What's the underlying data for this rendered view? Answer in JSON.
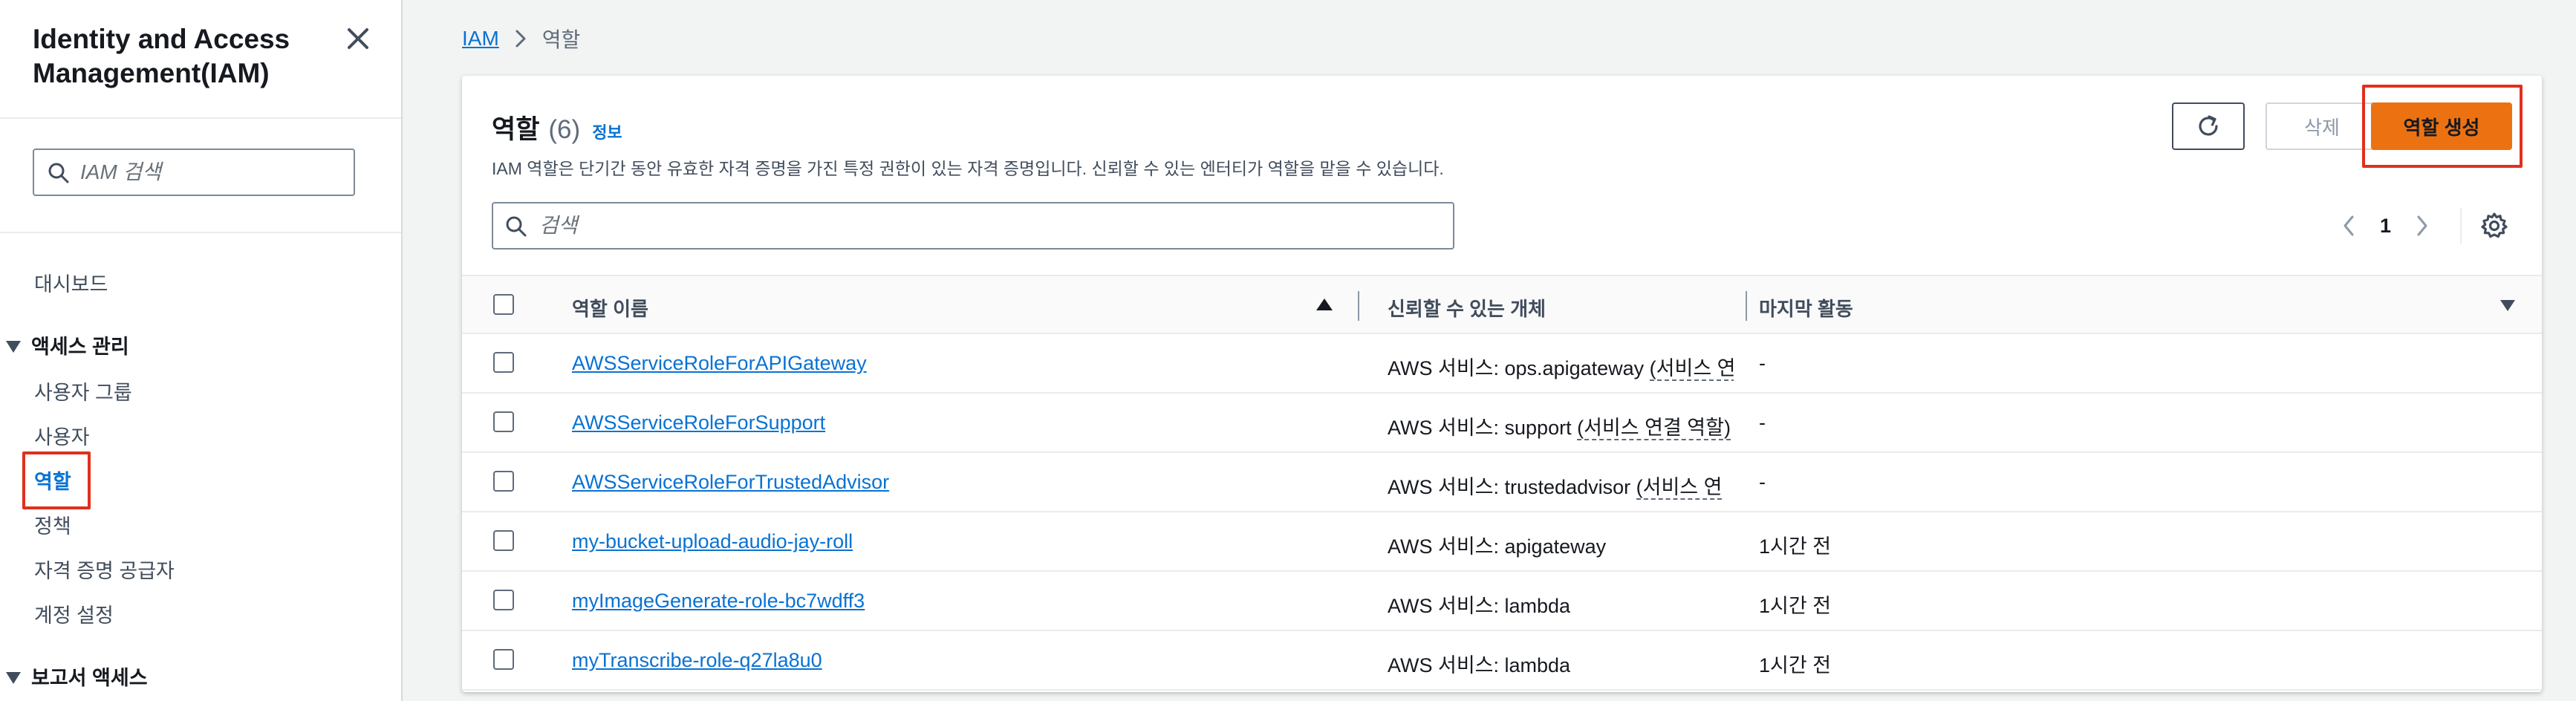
{
  "sidebar": {
    "title": "Identity and Access Management(IAM)",
    "search_placeholder": "IAM 검색",
    "dashboard": "대시보드",
    "access_section": "액세스 관리",
    "items": [
      "사용자 그룹",
      "사용자",
      "역할",
      "정책",
      "자격 증명 공급자",
      "계정 설정"
    ],
    "active_item": "역할",
    "report_section": "보고서 액세스"
  },
  "breadcrumb": {
    "root": "IAM",
    "current": "역할"
  },
  "panel": {
    "title": "역할",
    "count": "(6)",
    "info_link": "정보",
    "description": "IAM 역할은 단기간 동안 유효한 자격 증명을 가진 특정 권한이 있는 자격 증명입니다. 신뢰할 수 있는 엔터티가 역할을 맡을 수 있습니다.",
    "delete_label": "삭제",
    "create_label": "역할 생성",
    "search_placeholder": "검색",
    "page": "1"
  },
  "table": {
    "headers": [
      "역할 이름",
      "신뢰할 수 있는 개체",
      "마지막 활동"
    ],
    "rows": [
      {
        "name": "AWSServiceRoleForAPIGateway",
        "entity_prefix": "AWS 서비스: ops.apigateway ",
        "entity_link": "(서비스 연",
        "activity": "-"
      },
      {
        "name": "AWSServiceRoleForSupport",
        "entity_prefix": "AWS 서비스: support ",
        "entity_link": "(서비스 연결 역할)",
        "activity": "-"
      },
      {
        "name": "AWSServiceRoleForTrustedAdvisor",
        "entity_prefix": "AWS 서비스: trustedadvisor ",
        "entity_link": "(서비스 연",
        "activity": "-"
      },
      {
        "name": "my-bucket-upload-audio-jay-roll",
        "entity_prefix": "AWS 서비스: apigateway",
        "entity_link": "",
        "activity": "1시간 전"
      },
      {
        "name": "myImageGenerate-role-bc7wdff3",
        "entity_prefix": "AWS 서비스: lambda",
        "entity_link": "",
        "activity": "1시간 전"
      },
      {
        "name": "myTranscribe-role-q27la8u0",
        "entity_prefix": "AWS 서비스: lambda",
        "entity_link": "",
        "activity": "1시간 전"
      }
    ]
  },
  "colors": {
    "accent": "#0972d3",
    "primary_button": "#ec7211",
    "highlight_box": "#e0301e"
  },
  "icons": [
    "close-icon",
    "search-icon",
    "refresh-icon",
    "chevron-left-icon",
    "chevron-right-icon",
    "settings-icon",
    "sort-ascending-icon",
    "caret-down-icon"
  ]
}
